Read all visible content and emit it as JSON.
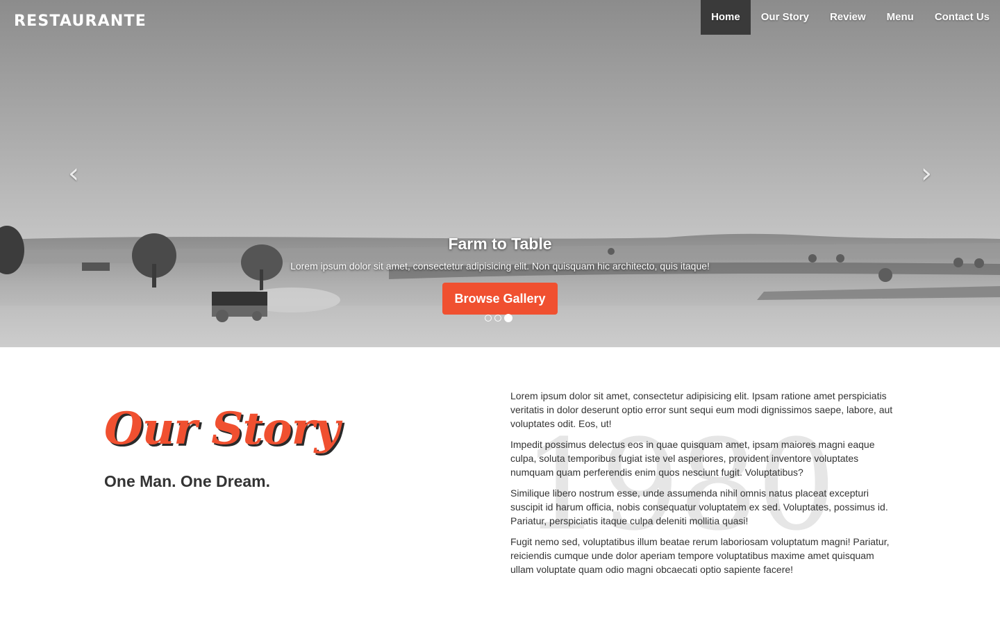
{
  "brand": "RESTAURANTE",
  "nav": [
    "Home",
    "Our Story",
    "Review",
    "Menu",
    "Contact Us"
  ],
  "nav_active": "Home",
  "carousel": {
    "prev_icon": "chevron-left-icon",
    "next_icon": "chevron-right-icon",
    "title": "Farm to Table",
    "text": "Lorem ipsum dolor sit amet, consectetur adipisicing elit. Non quisquam hic architecto, quis itaque!",
    "button": "Browse Gallery",
    "slides": 3,
    "active_slide": 3
  },
  "story": {
    "heading": "Our Story",
    "subheading": "One Man. One Dream.",
    "watermark": "1980",
    "paragraphs": [
      "Lorem ipsum dolor sit amet, consectetur adipisicing elit. Ipsam ratione amet perspiciatis veritatis in dolor deserunt optio error sunt sequi eum modi dignissimos saepe, labore, aut voluptates odit. Eos, ut!",
      "Impedit possimus delectus eos in quae quisquam amet, ipsam maiores magni eaque culpa, soluta temporibus fugiat iste vel asperiores, provident inventore voluptates numquam quam perferendis enim quos nesciunt fugit. Voluptatibus?",
      "Similique libero nostrum esse, unde assumenda nihil omnis natus placeat excepturi suscipit id harum officia, nobis consequatur voluptatem ex sed. Voluptates, possimus id. Pariatur, perspiciatis itaque culpa deleniti mollitia quasi!",
      "Fugit nemo sed, voluptatibus illum beatae rerum laboriosam voluptatum magni! Pariatur, reiciendis cumque unde dolor aperiam tempore voluptatibus maxime amet quisquam ullam voluptate quam odio magni obcaecati optio sapiente facere!"
    ]
  },
  "colors": {
    "accent": "#f05030",
    "nav_active_bg": "#3a3a3a",
    "text": "#333333",
    "watermark": "#e6e6e6"
  }
}
